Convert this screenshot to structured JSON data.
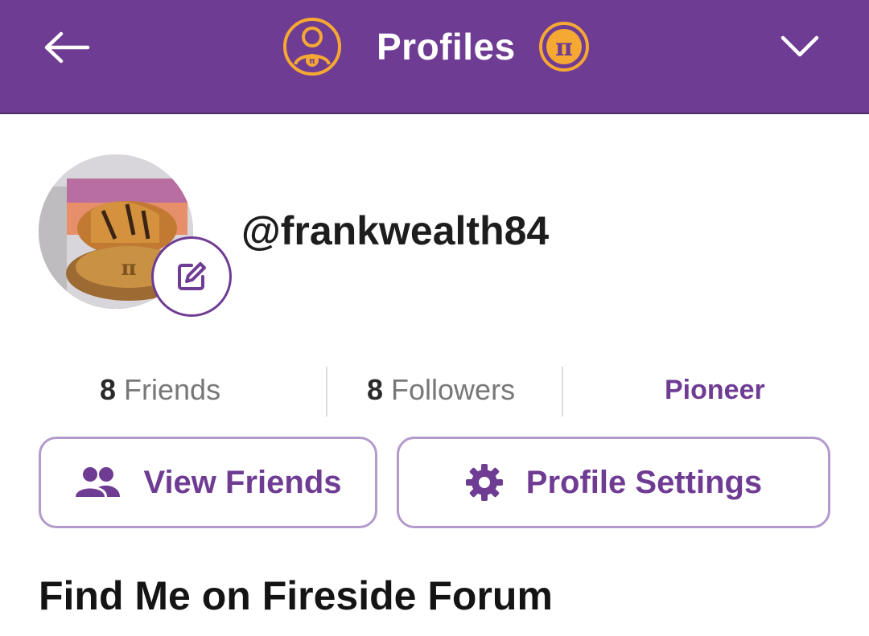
{
  "header": {
    "title": "Profiles",
    "back_icon": "arrow-left-icon",
    "profile_icon": "pi-user-icon",
    "pi_coin_icon": "pi-coin-icon",
    "dropdown_icon": "chevron-down-icon",
    "colors": {
      "background": "#6f3c93",
      "icon_accent": "#f6a932",
      "text": "#ffffff"
    }
  },
  "profile": {
    "username": "@frankwealth84",
    "avatar_icon": "avatar-photo",
    "edit_icon": "edit-icon"
  },
  "stats": {
    "friends_count": "8",
    "friends_label": "Friends",
    "followers_count": "8",
    "followers_label": "Followers",
    "role": "Pioneer"
  },
  "actions": {
    "view_friends_label": "View Friends",
    "view_friends_icon": "people-icon",
    "profile_settings_label": "Profile Settings",
    "profile_settings_icon": "gear-icon"
  },
  "section": {
    "title": "Find Me on Fireside Forum"
  },
  "theme": {
    "accent": "#6f3c93",
    "border": "#b49acb"
  }
}
